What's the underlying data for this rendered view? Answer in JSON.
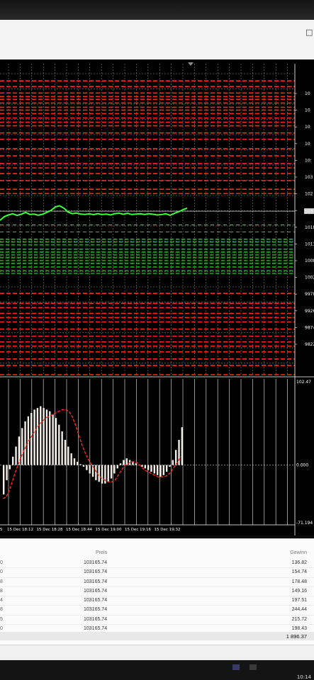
{
  "window": {
    "close_glyph": "□"
  },
  "chart_data": [
    {
      "type": "line",
      "title": "",
      "series": [
        {
          "x": [
            0,
            6,
            12,
            18,
            24,
            30,
            36,
            42,
            48,
            54,
            60,
            66,
            72,
            78,
            84,
            90,
            96,
            102,
            108,
            114,
            120,
            126,
            132,
            138,
            144,
            150,
            156,
            162,
            168,
            174,
            180,
            186,
            192,
            198,
            204,
            210,
            216,
            222,
            228,
            234,
            240,
            246,
            252,
            258,
            264
          ],
          "values": [
            102520,
            102780,
            102900,
            102980,
            102870,
            102950,
            103080,
            102940,
            102960,
            102880,
            102950,
            103080,
            103220,
            103460,
            103540,
            103380,
            103100,
            102990,
            103030,
            102960,
            102940,
            102980,
            102920,
            102990,
            102930,
            102960,
            102900,
            102990,
            103020,
            102950,
            103010,
            102930,
            102960,
            102980,
            102930,
            102980,
            102950,
            102900,
            102930,
            102980,
            102880,
            103010,
            103120,
            103260,
            103380
          ]
        }
      ],
      "levels_red": [
        112300,
        111900,
        111450,
        111200,
        111000,
        110750,
        110450,
        110250,
        110000,
        109700,
        109400,
        109150,
        108650,
        108200,
        107550,
        107050,
        106500,
        106200,
        105800,
        105300,
        104700,
        104400,
        97400,
        96700,
        96400,
        96000,
        95700,
        95400,
        94900,
        94400,
        94000,
        93700,
        93300,
        92800,
        92350,
        91700
      ],
      "levels_green": [
        101200,
        101000,
        100800,
        100500,
        100300,
        100100,
        99900,
        99700,
        99500,
        99250,
        99000,
        98800
      ],
      "price_line": 103165.74,
      "price_label": "103",
      "y_ticks": [
        "10",
        "10",
        "10",
        "10",
        "10:",
        "103",
        "102",
        "102",
        "1018",
        "1013",
        "1008",
        "1002",
        "99780",
        "99263",
        "98746",
        "98228"
      ],
      "ylim": [
        91700,
        113500
      ]
    },
    {
      "type": "bar",
      "title": "",
      "values": [
        -35,
        -18,
        -5,
        10,
        22,
        34,
        44,
        52,
        58,
        62,
        66,
        68,
        70,
        68,
        66,
        64,
        60,
        56,
        48,
        40,
        30,
        22,
        14,
        8,
        4,
        1,
        -2,
        -6,
        -10,
        -14,
        -18,
        -20,
        -22,
        -22,
        -20,
        -16,
        -10,
        -4,
        2,
        6,
        8,
        6,
        4,
        2,
        0,
        -2,
        -4,
        -6,
        -8,
        -10,
        -12,
        -14,
        -12,
        -8,
        -2,
        6,
        18,
        30,
        45
      ],
      "signal": [
        -40,
        -38,
        -30,
        -18,
        -6,
        4,
        14,
        22,
        30,
        36,
        42,
        48,
        52,
        56,
        58,
        60,
        62,
        64,
        66,
        66,
        64,
        58,
        48,
        36,
        24,
        14,
        6,
        0,
        -6,
        -12,
        -16,
        -18,
        -20,
        -20,
        -18,
        -12,
        -6,
        0,
        2,
        4,
        4,
        2,
        -2,
        -6,
        -8,
        -10,
        -12,
        -14,
        -14,
        -14,
        -12,
        -8,
        -2,
        4,
        10
      ],
      "y_ticks": [
        "102.47",
        "0.000",
        "-71.194"
      ],
      "ylim": [
        -71.194,
        102.47
      ]
    }
  ],
  "time_axis": [
    "5",
    "15 Dec 18:12",
    "15 Dec 18:28",
    "15 Dec 18:44",
    "15 Dec 19:00",
    "15 Dec 19:16",
    "15 Dec 19:32"
  ],
  "trades": {
    "header_preis": "Preis",
    "header_gewinn": "Gewinn",
    "rows": [
      {
        "c0": "0",
        "preis": "103165.74",
        "gewinn": "136.82"
      },
      {
        "c0": "0",
        "preis": "103165.74",
        "gewinn": "154.74"
      },
      {
        "c0": "8",
        "preis": "103165.74",
        "gewinn": "178.48"
      },
      {
        "c0": "8",
        "preis": "103165.74",
        "gewinn": "149.16"
      },
      {
        "c0": "4",
        "preis": "103165.74",
        "gewinn": "197.51"
      },
      {
        "c0": "8",
        "preis": "103165.74",
        "gewinn": "244.44"
      },
      {
        "c0": "5",
        "preis": "103165.74",
        "gewinn": "215.72"
      },
      {
        "c0": "0",
        "preis": "103165.74",
        "gewinn": "198.43"
      }
    ],
    "total": "1 896.37"
  },
  "taskbar": {
    "clock": "10:14"
  },
  "colors": {
    "bg": "#000000",
    "grid": "#9a9a9a",
    "red": "#ff2a17",
    "green": "#22d022",
    "price_green": "#3cff3c"
  }
}
